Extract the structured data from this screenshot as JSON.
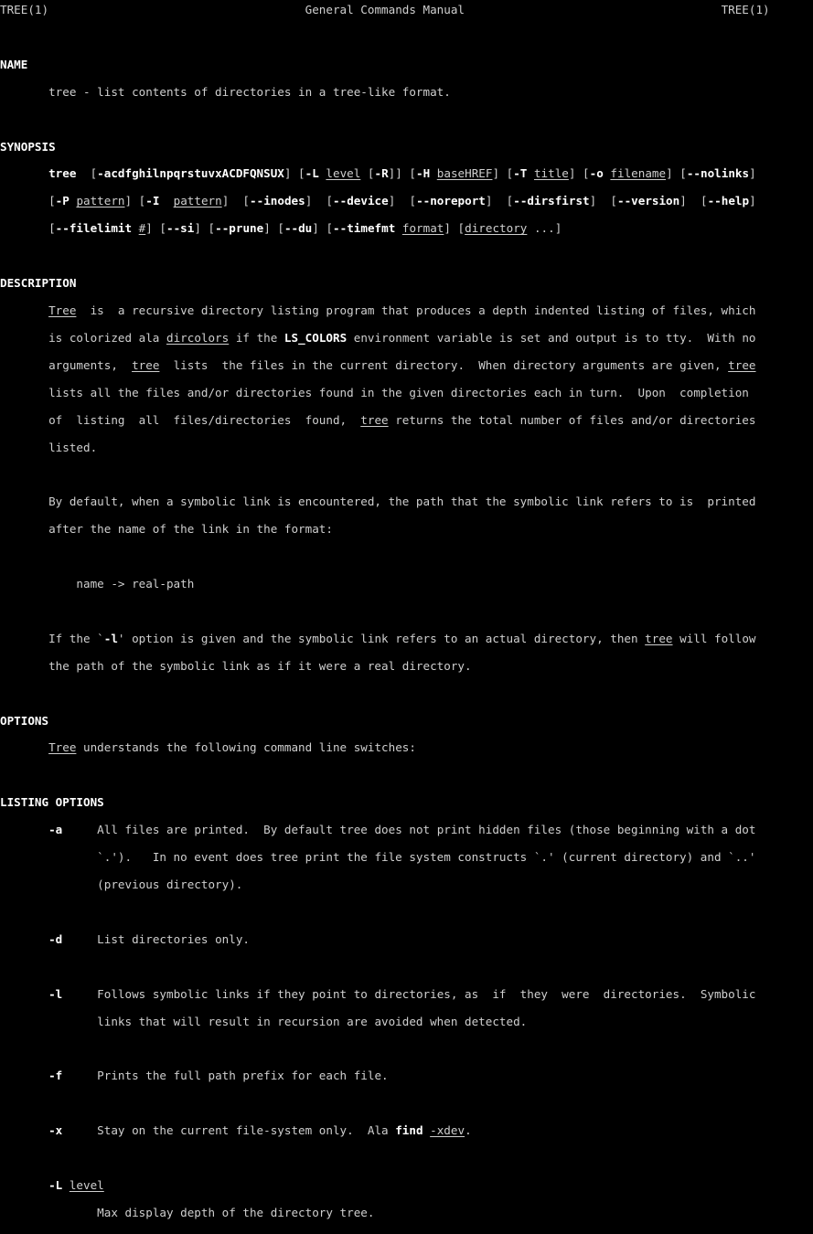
{
  "terminal": {
    "background": "#000000",
    "foreground": "#cfcfcf",
    "bold_color": "#ffffff",
    "columns": 122,
    "rows": 46
  },
  "manpage": {
    "name": "TREE",
    "section": "1",
    "header_left": "TREE(1)",
    "header_center": "General Commands Manual",
    "header_right": "TREE(1)"
  },
  "sections": {
    "name": {
      "heading": "NAME",
      "body": "tree - list contents of directories in a tree-like format."
    },
    "synopsis": {
      "heading": "SYNOPSIS",
      "command": "tree",
      "line1": {
        "opts": "-acdfghilnpqrstuvxACDFQNSUX",
        "L": "-L",
        "L_arg": "level",
        "R": "-R",
        "H": "-H",
        "H_arg": "baseHREF",
        "T": "-T",
        "T_arg": "title",
        "o": "-o",
        "o_arg": "filename",
        "nolinks": "--nolinks"
      },
      "line2": {
        "P": "-P",
        "P_arg": "pattern",
        "I": "-I",
        "I_arg": "pattern",
        "inodes": "--inodes",
        "device": "--device",
        "noreport": "--noreport",
        "dirsfirst": "--dirsfirst",
        "version": "--version",
        "help": "--help"
      },
      "line3": {
        "filelimit": "--filelimit",
        "filelimit_arg": "#",
        "si": "--si",
        "prune": "--prune",
        "du": "--du",
        "timefmt": "--timefmt",
        "timefmt_arg": "format",
        "directory": "directory",
        "ellipsis": "..."
      }
    },
    "description": {
      "heading": "DESCRIPTION",
      "p1_l1_a": "Tree",
      "p1_l1_b": "  is  a recursive directory listing program that produces a depth indented listing of files, which",
      "p1_l2_a": "is colorized ala ",
      "p1_l2_b": "dircolors",
      "p1_l2_c": " if the ",
      "p1_l2_d": "LS_COLORS",
      "p1_l2_e": " environment variable is set and output is to tty.  With no",
      "p1_l3_a": "arguments,  ",
      "p1_l3_b": "tree",
      "p1_l3_c": "  lists  the files in the current directory.  When directory arguments are given, ",
      "p1_l3_d": "tree",
      "p1_l4": "lists all the files and/or directories found in the given directories each in turn.  Upon  completion",
      "p1_l5_a": "of  listing  all  files/directories  found,  ",
      "p1_l5_b": "tree",
      "p1_l5_c": " returns the total number of files and/or directories",
      "p1_l6": "listed.",
      "p2_l1": "By default, when a symbolic link is encountered, the path that the symbolic link refers to is  printed",
      "p2_l2": "after the name of the link in the format:",
      "p3": "name -> real-path",
      "p4_l1_a": "If the `",
      "p4_l1_b": "-l",
      "p4_l1_c": "' option is given and the symbolic link refers to an actual directory, then ",
      "p4_l1_d": "tree",
      "p4_l1_e": " will follow",
      "p4_l2": "the path of the symbolic link as if it were a real directory."
    },
    "options": {
      "heading": "OPTIONS",
      "intro_a": "Tree",
      "intro_b": " understands the following command line switches:"
    },
    "listing_options": {
      "heading": "LISTING OPTIONS",
      "items": [
        {
          "flag": "-a",
          "arg": "",
          "lines": [
            "All files are printed.  By default tree does not print hidden files (those beginning with a dot",
            "`.').   In no event does tree print the file system constructs `.' (current directory) and `..'",
            "(previous directory)."
          ]
        },
        {
          "flag": "-d",
          "arg": "",
          "lines": [
            "List directories only."
          ]
        },
        {
          "flag": "-l",
          "arg": "",
          "lines": [
            "Follows symbolic links if they point to directories, as  if  they  were  directories.  Symbolic",
            "links that will result in recursion are avoided when detected."
          ]
        },
        {
          "flag": "-f",
          "arg": "",
          "lines": [
            "Prints the full path prefix for each file."
          ]
        },
        {
          "flag": "-x",
          "arg": "",
          "lines": [
            "Stay on the current file-system only.  Ala find -xdev."
          ],
          "inline_bold": "find",
          "inline_underline": "-xdev"
        },
        {
          "flag": "-L",
          "arg": "level",
          "lines": [
            "Max display depth of the directory tree."
          ]
        }
      ]
    }
  }
}
